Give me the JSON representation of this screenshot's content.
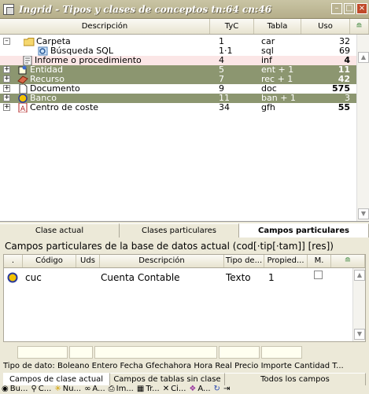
{
  "window": {
    "title": "Ingrid - Tipos y clases de conceptos tn:64 cn:46"
  },
  "upper": {
    "headers": {
      "desc": "Descripción",
      "tyc": "TyC",
      "tabla": "Tabla",
      "uso": "Uso",
      "x": "≘"
    },
    "rows": [
      {
        "label": "Carpeta",
        "tyc": "1",
        "tabla": "car",
        "uso": "32"
      },
      {
        "label": "Búsqueda SQL",
        "tyc": "1·1",
        "tabla": "sql",
        "uso": "69"
      },
      {
        "label": "Informe o procedimiento",
        "tyc": "4",
        "tabla": "inf",
        "uso": "4"
      },
      {
        "label": "Entidad",
        "tyc": "5",
        "tabla": "ent + 1",
        "uso": "11"
      },
      {
        "label": "Recurso",
        "tyc": "7",
        "tabla": "rec + 1",
        "uso": "42"
      },
      {
        "label": "Documento",
        "tyc": "9",
        "tabla": "doc",
        "uso": "575"
      },
      {
        "label": "Banco",
        "tyc": "11",
        "tabla": "ban + 1",
        "uso": "3"
      },
      {
        "label": "Centro de coste",
        "tyc": "34",
        "tabla": "gfh",
        "uso": "55"
      }
    ]
  },
  "tabs_top": [
    "Clase actual",
    "Clases particulares",
    "Campos particulares"
  ],
  "section_title": "Campos particulares de la base de datos actual (cod[·tip[·tam]] [res])",
  "lower": {
    "headers": {
      "dot": ".",
      "codigo": "Código",
      "uds": "Uds",
      "descripcion": "Descripción",
      "tipo": "Tipo de...",
      "propied": "Propied...",
      "m": "M.",
      "x": "≘"
    },
    "row": {
      "codigo": "cuc",
      "descripcion": "Cuenta Contable",
      "tipo": "Texto",
      "propied": "1"
    }
  },
  "types_line": "Tipo de dato: Boleano Entero Fecha Gfechahora Hora Real Precio Importe Cantidad T...",
  "tabs_bottom": [
    "Campos de clase actual",
    "Campos de tablas sin clase",
    "Todos los campos"
  ],
  "toolbar": [
    {
      "icon": "binoculars-icon",
      "label": "Bu..."
    },
    {
      "icon": "search-icon",
      "label": "C..."
    },
    {
      "icon": "new-icon",
      "label": "Nu..."
    },
    {
      "icon": "link-icon",
      "label": "A..."
    },
    {
      "icon": "printer-icon",
      "label": "Im..."
    },
    {
      "icon": "network-icon",
      "label": "Tr..."
    },
    {
      "icon": "close-icon",
      "label": "Ci..."
    },
    {
      "icon": "eraser-icon",
      "label": "A..."
    },
    {
      "icon": "refresh-icon",
      "label": ""
    },
    {
      "icon": "exit-icon",
      "label": ""
    }
  ]
}
